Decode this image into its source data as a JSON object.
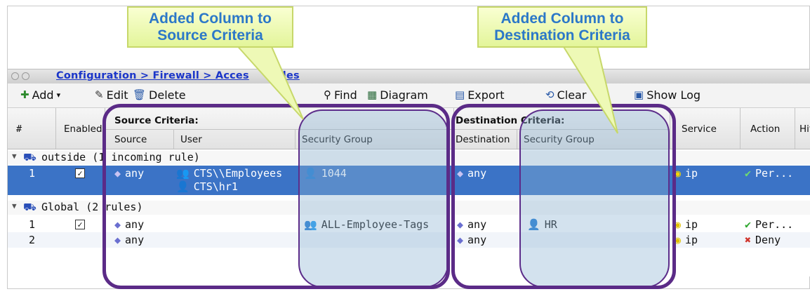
{
  "callouts": {
    "source_line1": "Added Column to",
    "source_line2": "Source Criteria",
    "dest_line1": "Added Column to",
    "dest_line2": "Destination Criteria"
  },
  "window": {
    "breadcrumb": "Configuration > Firewall > Access Rules",
    "breadcrumb_visible_a": "Configuration > Firewall > Acces",
    "breadcrumb_visible_b": "les"
  },
  "toolbar": {
    "add": "Add",
    "edit": "Edit",
    "delete": "Delete",
    "find": "Find",
    "diagram": "Diagram",
    "export": "Export",
    "clear": "Clear",
    "show_log": "Show Log"
  },
  "header": {
    "num": "#",
    "enabled": "Enabled",
    "source_criteria": "Source Criteria:",
    "source": "Source",
    "user": "User",
    "security_group": "Security Group",
    "destination_criteria": "Destination Criteria:",
    "destination": "Destination",
    "dest_security_group": "Security Group",
    "service": "Service",
    "action": "Action",
    "hits": "Hit"
  },
  "groups": [
    {
      "label": "outside (1 incoming rule)"
    },
    {
      "label": "Global (2 rules)"
    }
  ],
  "rows": [
    {
      "num": "1",
      "enabled": true,
      "source": "any",
      "user1": "CTS\\\\Employees",
      "user2": "CTS\\hr1",
      "sgt": "1044",
      "destination": "any",
      "dest_sgt": "",
      "service": "ip",
      "action": "Per..."
    },
    {
      "num": "1",
      "enabled": true,
      "source": "any",
      "user1": "",
      "user2": "",
      "sgt": "ALL-Employee-Tags",
      "destination": "any",
      "dest_sgt": "HR",
      "service": "ip",
      "action": "Per..."
    },
    {
      "num": "2",
      "enabled": false,
      "source": "any",
      "user1": "",
      "user2": "",
      "sgt": "",
      "destination": "any",
      "dest_sgt": "",
      "service": "ip",
      "action": "Deny"
    }
  ],
  "colors": {
    "ring": "#5b2b87",
    "shade": "#8cb4d2",
    "callout_text": "#2c78c8",
    "callout_bg": "#eef9b6",
    "selection": "#3b73c6",
    "link": "#1b36c9"
  },
  "icons": {
    "add": "plus-icon",
    "edit": "edit-icon",
    "delete": "trash-icon",
    "find": "search-icon",
    "diagram": "diagram-icon",
    "export": "export-icon",
    "clear": "clear-icon",
    "show_log": "log-icon"
  }
}
